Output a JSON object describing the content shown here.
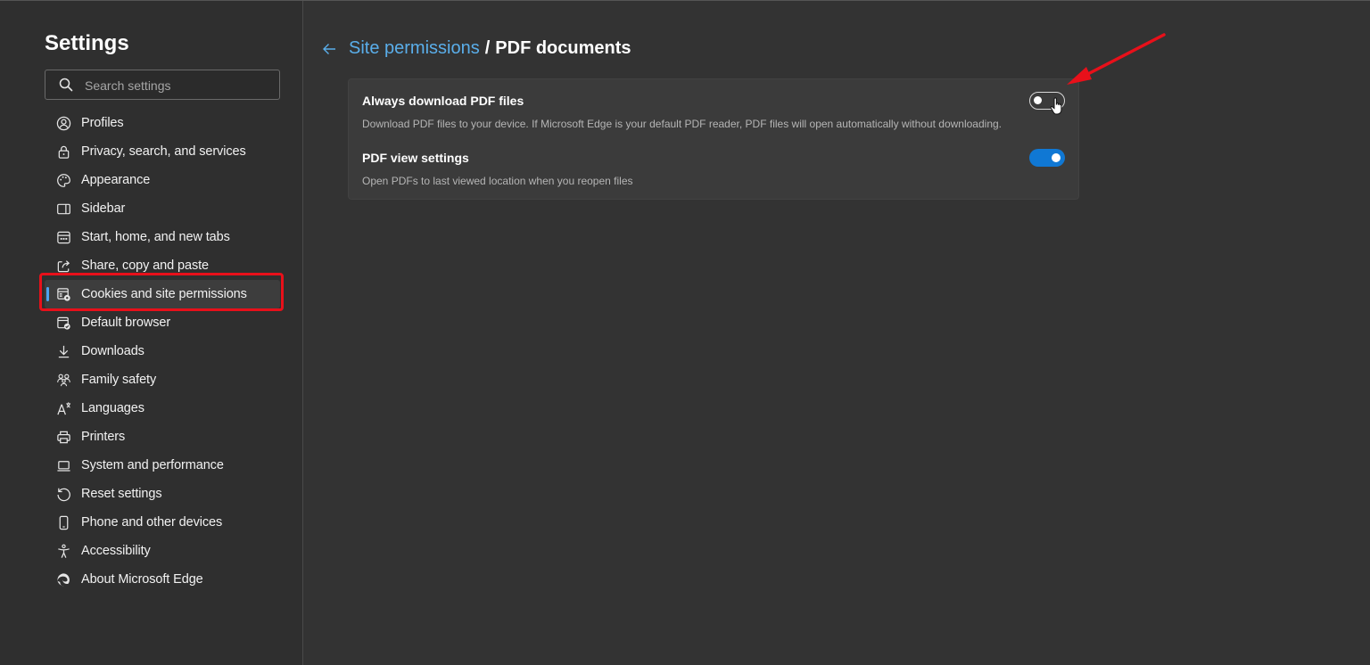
{
  "sidebar": {
    "title": "Settings",
    "search": {
      "placeholder": "Search settings",
      "value": ""
    },
    "items": [
      {
        "label": "Profiles",
        "icon": "profile-icon"
      },
      {
        "label": "Privacy, search, and services",
        "icon": "lock-icon"
      },
      {
        "label": "Appearance",
        "icon": "palette-icon"
      },
      {
        "label": "Sidebar",
        "icon": "sidebar-icon"
      },
      {
        "label": "Start, home, and new tabs",
        "icon": "home-tabs-icon"
      },
      {
        "label": "Share, copy and paste",
        "icon": "share-icon"
      },
      {
        "label": "Cookies and site permissions",
        "icon": "cookies-permissions-icon",
        "active": true
      },
      {
        "label": "Default browser",
        "icon": "default-browser-icon"
      },
      {
        "label": "Downloads",
        "icon": "download-icon"
      },
      {
        "label": "Family safety",
        "icon": "family-icon"
      },
      {
        "label": "Languages",
        "icon": "language-icon"
      },
      {
        "label": "Printers",
        "icon": "printer-icon"
      },
      {
        "label": "System and performance",
        "icon": "laptop-icon"
      },
      {
        "label": "Reset settings",
        "icon": "reset-icon"
      },
      {
        "label": "Phone and other devices",
        "icon": "phone-icon"
      },
      {
        "label": "Accessibility",
        "icon": "accessibility-icon"
      },
      {
        "label": "About Microsoft Edge",
        "icon": "edge-logo-icon"
      }
    ]
  },
  "main": {
    "breadcrumb": {
      "parent": "Site permissions",
      "separator": "/",
      "current": "PDF documents"
    },
    "settings": [
      {
        "title": "Always download PDF files",
        "description": "Download PDF files to your device. If Microsoft Edge is your default PDF reader, PDF files will open automatically without downloading.",
        "enabled": false
      },
      {
        "title": "PDF view settings",
        "description": "Open PDFs to last viewed location when you reopen files",
        "enabled": true
      }
    ]
  },
  "colors": {
    "accent": "#1078d4",
    "link": "#5aaeea",
    "annotation": "#e8101a",
    "background": "#333333"
  }
}
